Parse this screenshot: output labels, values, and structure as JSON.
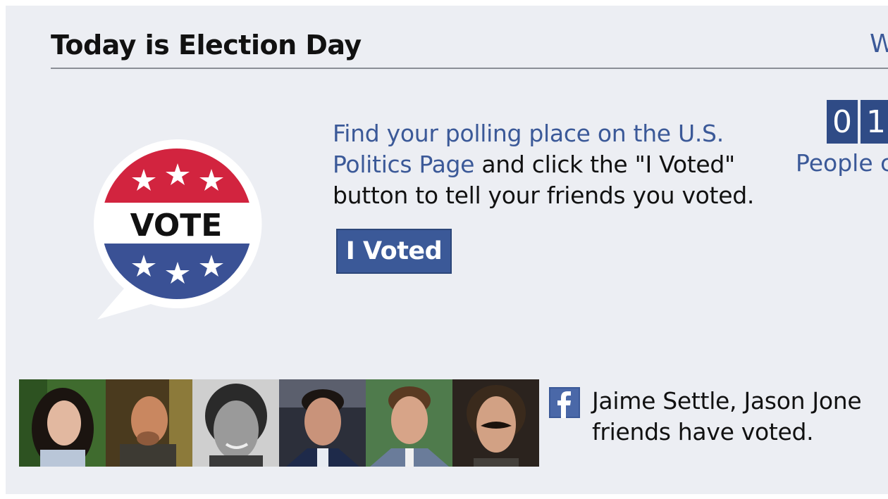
{
  "header": {
    "title": "Today is Election Day",
    "link_fragment": "W"
  },
  "badge": {
    "label": "VOTE",
    "colors": {
      "red": "#d2243f",
      "blue": "#3a5195",
      "white": "#ffffff"
    }
  },
  "message": {
    "link_text": "Find your polling place on the U.S. Politics Page",
    "rest_text": " and click the \"I Voted\" button to tell your friends you voted."
  },
  "voted_button": {
    "label": "I Voted"
  },
  "counter": {
    "digits": [
      "0",
      "1"
    ],
    "label": "People c"
  },
  "friends": {
    "photos": [
      "friend-photo-1",
      "friend-photo-2",
      "friend-photo-3",
      "friend-photo-4",
      "friend-photo-5",
      "friend-photo-6"
    ],
    "line1": "Jaime Settle, Jason Jone",
    "line2": "friends have voted."
  },
  "icons": {
    "facebook": "facebook-icon"
  },
  "colors": {
    "brand": "#3b5998",
    "panel": "#eceef3"
  }
}
